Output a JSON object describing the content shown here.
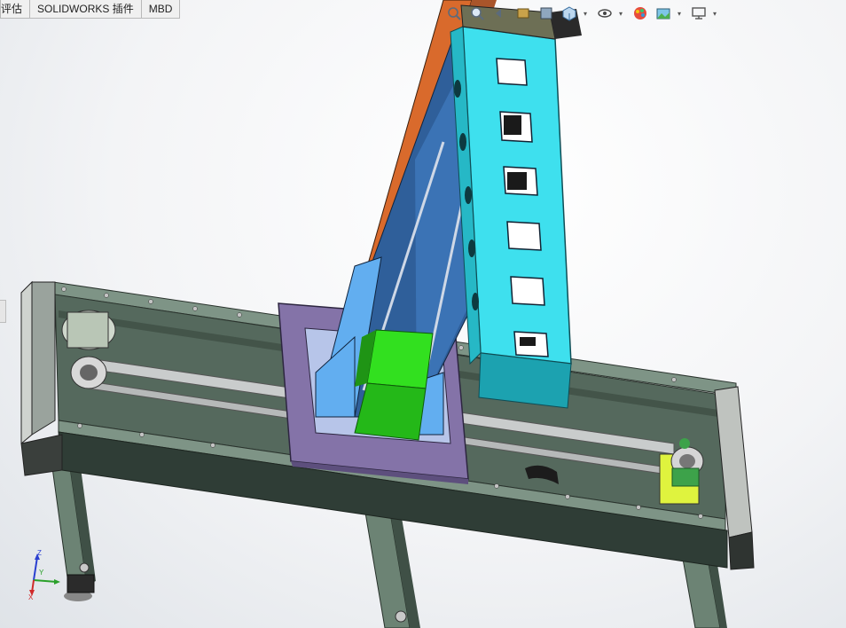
{
  "tabs": [
    {
      "label": "评估"
    },
    {
      "label": "SOLIDWORKS 插件"
    },
    {
      "label": "MBD"
    }
  ],
  "heads_up_toolbar": {
    "icons": [
      "zoom-to-fit-icon",
      "zoom-area-icon",
      "previous-view-icon",
      "section-view-icon",
      "dynamic-annotation-icon",
      "view-orientation-icon",
      "display-style-icon",
      "hide-show-items-icon",
      "edit-appearance-icon",
      "apply-scene-icon",
      "view-settings-icon"
    ]
  },
  "triad": {
    "x": "X",
    "y": "Y",
    "z": "Z"
  },
  "colors": {
    "frame": "#5f7468",
    "frame_dark": "#2f3d36",
    "carriage": "#8473a8",
    "column": "#3ee0ee",
    "column_shadow": "#26b8c6",
    "guide_blue": "#2f5f9a",
    "light_blue": "#62aef0",
    "orange": "#d96a2c",
    "green_block": "#32e01f",
    "motor": "#b8d870"
  }
}
